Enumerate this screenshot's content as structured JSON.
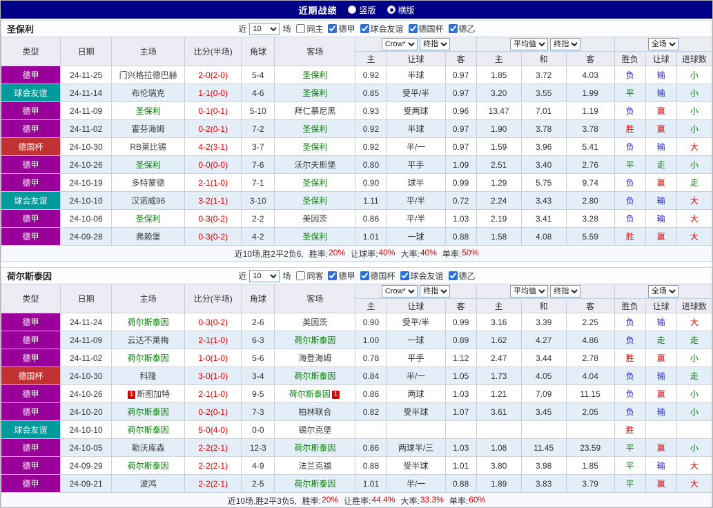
{
  "topbar": {
    "title": "近期战绩",
    "options": [
      {
        "label": "竖版",
        "selected": false
      },
      {
        "label": "横版",
        "selected": true
      }
    ]
  },
  "table_header": {
    "type": "类型",
    "date": "日期",
    "home": "主场",
    "score": "比分(半场)",
    "corner": "角球",
    "away": "客场",
    "odds_source": "Crow*",
    "odds_stage": "终指",
    "avg_source": "平均值",
    "avg_stage": "终指",
    "scope": "全场",
    "sub": [
      "主",
      "让球",
      "客",
      "主",
      "和",
      "客",
      "胜负",
      "让球",
      "进球数"
    ]
  },
  "colors": {
    "topbar_bg": "#000086",
    "focal_team": "#008000",
    "score": "#E00000",
    "league": {
      "德甲": "#990099",
      "球会友谊": "#009A9A",
      "德国杯": "#C13232"
    },
    "result": {
      "胜": "#E00000",
      "负": "#2222CC",
      "平": "#008000",
      "赢": "#E00000",
      "输": "#2222CC",
      "走": "#008000",
      "大": "#E00000",
      "小": "#008000"
    }
  },
  "sections": [
    {
      "team": "圣保利",
      "controls": {
        "recent_label": "近",
        "recent_value": "10",
        "suffix_label": "场",
        "venue": {
          "label": "同主",
          "checked": false
        },
        "leagues": [
          {
            "label": "德甲",
            "checked": true
          },
          {
            "label": "球会友谊",
            "checked": true
          },
          {
            "label": "德国杯",
            "checked": true
          },
          {
            "label": "德乙",
            "checked": true
          }
        ]
      },
      "rows": [
        {
          "league": "德甲",
          "date": "24-11-25",
          "home": "门兴格拉德巴赫",
          "score": "2-0(2-0)",
          "corner": "5-4",
          "away": "圣保利",
          "odds": [
            "0.92",
            "半球",
            "0.97"
          ],
          "avg": [
            "1.85",
            "3.72",
            "4.03"
          ],
          "result": [
            "负",
            "输",
            "小"
          ]
        },
        {
          "league": "球会友谊",
          "date": "24-11-14",
          "home": "布伦瑞克",
          "score": "1-1(0-0)",
          "corner": "4-6",
          "away": "圣保利",
          "odds": [
            "0.85",
            "受平/半",
            "0.97"
          ],
          "avg": [
            "3.20",
            "3.55",
            "1.99"
          ],
          "result": [
            "平",
            "输",
            "小"
          ]
        },
        {
          "league": "德甲",
          "date": "24-11-09",
          "home": "圣保利",
          "score": "0-1(0-1)",
          "corner": "5-10",
          "away": "拜仁慕尼黑",
          "odds": [
            "0.93",
            "受两球",
            "0.96"
          ],
          "avg": [
            "13.47",
            "7.01",
            "1.19"
          ],
          "result": [
            "负",
            "赢",
            "小"
          ]
        },
        {
          "league": "德甲",
          "date": "24-11-02",
          "home": "霍芬海姆",
          "score": "0-2(0-1)",
          "corner": "7-2",
          "away": "圣保利",
          "odds": [
            "0.92",
            "半球",
            "0.97"
          ],
          "avg": [
            "1.90",
            "3.78",
            "3.78"
          ],
          "result": [
            "胜",
            "赢",
            "小"
          ]
        },
        {
          "league": "德国杯",
          "date": "24-10-30",
          "home": "RB莱比锡",
          "score": "4-2(3-1)",
          "corner": "3-7",
          "away": "圣保利",
          "odds": [
            "0.92",
            "半/一",
            "0.97"
          ],
          "avg": [
            "1.59",
            "3.96",
            "5.41"
          ],
          "result": [
            "负",
            "输",
            "大"
          ]
        },
        {
          "league": "德甲",
          "date": "24-10-26",
          "home": "圣保利",
          "score": "0-0(0-0)",
          "corner": "7-6",
          "away": "沃尔夫斯堡",
          "odds": [
            "0.80",
            "平手",
            "1.09"
          ],
          "avg": [
            "2.51",
            "3.40",
            "2.76"
          ],
          "result": [
            "平",
            "走",
            "小"
          ]
        },
        {
          "league": "德甲",
          "date": "24-10-19",
          "home": "多特蒙德",
          "score": "2-1(1-0)",
          "corner": "7-1",
          "away": "圣保利",
          "odds": [
            "0.90",
            "球半",
            "0.99"
          ],
          "avg": [
            "1.29",
            "5.75",
            "9.74"
          ],
          "result": [
            "负",
            "赢",
            "走"
          ]
        },
        {
          "league": "球会友谊",
          "date": "24-10-10",
          "home": "汉诺威96",
          "score": "3-2(1-1)",
          "corner": "3-10",
          "away": "圣保利",
          "odds": [
            "1.11",
            "平/半",
            "0.72"
          ],
          "avg": [
            "2.24",
            "3.43",
            "2.80"
          ],
          "result": [
            "负",
            "输",
            "大"
          ]
        },
        {
          "league": "德甲",
          "date": "24-10-06",
          "home": "圣保利",
          "score": "0-3(0-2)",
          "corner": "2-2",
          "away": "美因茨",
          "odds": [
            "0.86",
            "平/半",
            "1.03"
          ],
          "avg": [
            "2.19",
            "3.41",
            "3.28"
          ],
          "result": [
            "负",
            "输",
            "大"
          ]
        },
        {
          "league": "德甲",
          "date": "24-09-28",
          "home": "弗赖堡",
          "score": "0-3(0-2)",
          "corner": "4-2",
          "away": "圣保利",
          "odds": [
            "1.01",
            "一球",
            "0.88"
          ],
          "avg": [
            "1.58",
            "4.08",
            "5.59"
          ],
          "result": [
            "胜",
            "赢",
            "大"
          ]
        }
      ],
      "summary": {
        "record": "近10场,胜2平2负6,",
        "stats": [
          {
            "label": "胜率:",
            "value": "20%"
          },
          {
            "label": "让球率:",
            "value": "40%"
          },
          {
            "label": "大率:",
            "value": "40%"
          },
          {
            "label": "单率:",
            "value": "50%"
          }
        ]
      }
    },
    {
      "team": "荷尔斯泰因",
      "controls": {
        "recent_label": "近",
        "recent_value": "10",
        "suffix_label": "场",
        "venue": {
          "label": "同客",
          "checked": false
        },
        "leagues": [
          {
            "label": "德甲",
            "checked": true
          },
          {
            "label": "德国杯",
            "checked": true
          },
          {
            "label": "球会友谊",
            "checked": true
          },
          {
            "label": "德乙",
            "checked": true
          }
        ]
      },
      "rows": [
        {
          "league": "德甲",
          "date": "24-11-24",
          "home": "荷尔斯泰因",
          "score": "0-3(0-2)",
          "corner": "2-6",
          "away": "美因茨",
          "odds": [
            "0.90",
            "受平/半",
            "0.99"
          ],
          "avg": [
            "3.16",
            "3.39",
            "2.25"
          ],
          "result": [
            "负",
            "输",
            "大"
          ]
        },
        {
          "league": "德甲",
          "date": "24-11-09",
          "home": "云达不莱梅",
          "score": "2-1(1-0)",
          "corner": "6-3",
          "away": "荷尔斯泰因",
          "odds": [
            "1.00",
            "一球",
            "0.89"
          ],
          "avg": [
            "1.62",
            "4.27",
            "4.86"
          ],
          "result": [
            "负",
            "走",
            "走"
          ]
        },
        {
          "league": "德甲",
          "date": "24-11-02",
          "home": "荷尔斯泰因",
          "score": "1-0(1-0)",
          "corner": "5-6",
          "away": "海登海姆",
          "odds": [
            "0.78",
            "平手",
            "1.12"
          ],
          "avg": [
            "2.47",
            "3.44",
            "2.78"
          ],
          "result": [
            "胜",
            "赢",
            "小"
          ]
        },
        {
          "league": "德国杯",
          "date": "24-10-30",
          "home": "科隆",
          "score": "3-0(1-0)",
          "corner": "3-4",
          "away": "荷尔斯泰因",
          "odds": [
            "0.84",
            "半/一",
            "1.05"
          ],
          "avg": [
            "1.73",
            "4.05",
            "4.04"
          ],
          "result": [
            "负",
            "输",
            "走"
          ]
        },
        {
          "league": "德甲",
          "date": "24-10-26",
          "home": "斯图加特",
          "home_card": 1,
          "score": "2-1(1-0)",
          "corner": "9-5",
          "away": "荷尔斯泰因",
          "away_card": 1,
          "odds": [
            "0.86",
            "两球",
            "1.03"
          ],
          "avg": [
            "1.21",
            "7.09",
            "11.15"
          ],
          "result": [
            "负",
            "赢",
            "小"
          ]
        },
        {
          "league": "德甲",
          "date": "24-10-20",
          "home": "荷尔斯泰因",
          "score": "0-2(0-1)",
          "corner": "7-3",
          "away": "柏林联合",
          "odds": [
            "0.82",
            "受半球",
            "1.07"
          ],
          "avg": [
            "3.61",
            "3.45",
            "2.05"
          ],
          "result": [
            "负",
            "输",
            "小"
          ]
        },
        {
          "league": "球会友谊",
          "date": "24-10-10",
          "home": "荷尔斯泰因",
          "score": "5-0(4-0)",
          "corner": "0-0",
          "away": "锡尔克堡",
          "odds": [
            "",
            "",
            ""
          ],
          "avg": [
            "",
            "",
            ""
          ],
          "result": [
            "胜",
            "",
            ""
          ]
        },
        {
          "league": "德甲",
          "date": "24-10-05",
          "home": "勒沃库森",
          "score": "2-2(2-1)",
          "corner": "12-3",
          "away": "荷尔斯泰因",
          "odds": [
            "0.86",
            "两球半/三",
            "1.03"
          ],
          "avg": [
            "1.08",
            "11.45",
            "23.59"
          ],
          "result": [
            "平",
            "赢",
            "小"
          ]
        },
        {
          "league": "德甲",
          "date": "24-09-29",
          "home": "荷尔斯泰因",
          "score": "2-2(2-1)",
          "corner": "4-9",
          "away": "法兰克福",
          "odds": [
            "0.88",
            "受半球",
            "1.01"
          ],
          "avg": [
            "3.80",
            "3.98",
            "1.85"
          ],
          "result": [
            "平",
            "输",
            "大"
          ]
        },
        {
          "league": "德甲",
          "date": "24-09-21",
          "home": "波鸿",
          "score": "2-2(2-1)",
          "corner": "2-5",
          "away": "荷尔斯泰因",
          "odds": [
            "1.01",
            "半/一",
            "0.88"
          ],
          "avg": [
            "1.89",
            "3.83",
            "3.79"
          ],
          "result": [
            "平",
            "赢",
            "大"
          ]
        }
      ],
      "summary": {
        "record": "近10场,胜2平3负5,",
        "stats": [
          {
            "label": "胜率:",
            "value": "20%"
          },
          {
            "label": "让胜率:",
            "value": "44.4%"
          },
          {
            "label": "大率:",
            "value": "33.3%"
          },
          {
            "label": "单率:",
            "value": "60%"
          }
        ]
      }
    }
  ]
}
